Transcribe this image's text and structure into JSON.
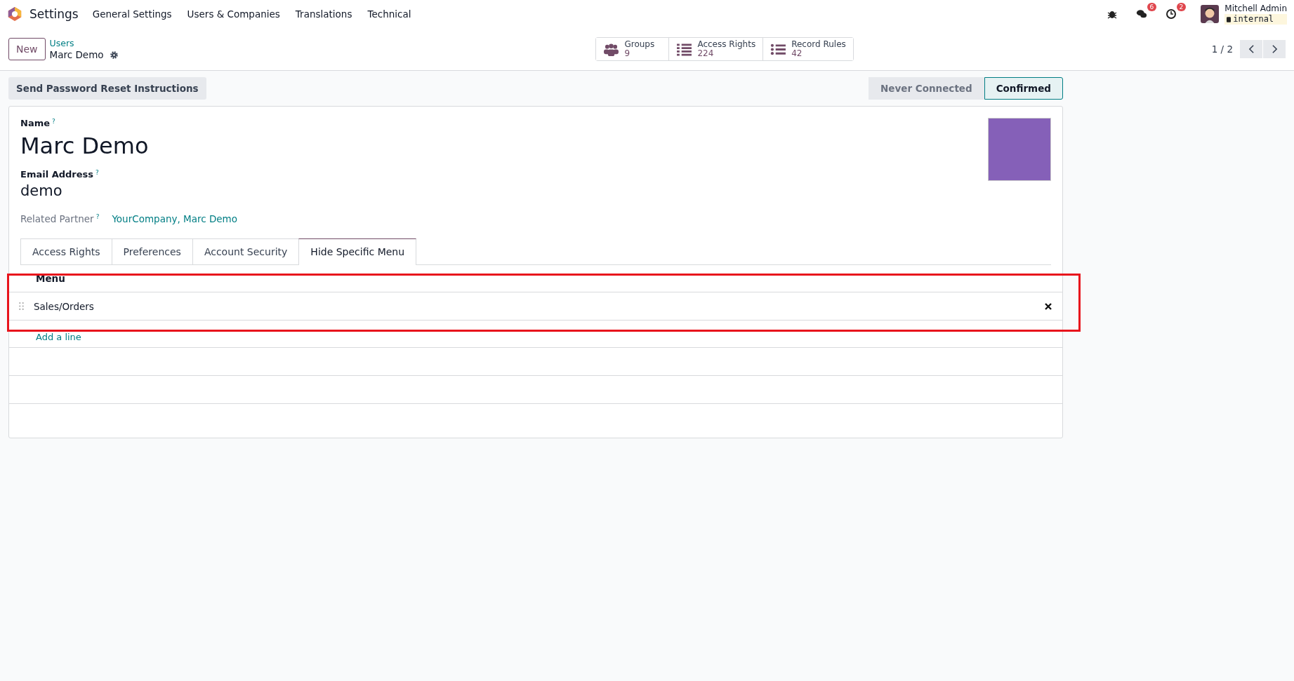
{
  "navbar": {
    "app_name": "Settings",
    "menu": [
      "General Settings",
      "Users & Companies",
      "Translations",
      "Technical"
    ],
    "messages_badge": "6",
    "activities_badge": "2",
    "user": {
      "name": "Mitchell Admin",
      "database": "internal"
    }
  },
  "control_panel": {
    "new_button": "New",
    "breadcrumb": "Users",
    "record_title": "Marc Demo",
    "smart_buttons": [
      {
        "kind": "groups",
        "label": "Groups",
        "value": "9"
      },
      {
        "kind": "list",
        "label": "Access Rights",
        "value": "224"
      },
      {
        "kind": "rules",
        "label": "Record Rules",
        "value": "42"
      }
    ],
    "pager": "1 / 2"
  },
  "action_button": "Send Password Reset Instructions",
  "statusbar": [
    {
      "label": "Never Connected",
      "selected": false
    },
    {
      "label": "Confirmed",
      "selected": true
    }
  ],
  "form": {
    "help_mark": "?",
    "name_label": "Name",
    "name_value": "Marc Demo",
    "email_label": "Email Address",
    "email_value": "demo",
    "partner_label": "Related Partner",
    "partner_value": "YourCompany, Marc Demo",
    "tabs": [
      {
        "label": "Access Rights",
        "selected": false
      },
      {
        "label": "Preferences",
        "selected": false
      },
      {
        "label": "Account Security",
        "selected": false
      },
      {
        "label": "Hide Specific Menu",
        "selected": true
      }
    ],
    "table": {
      "column": "Menu",
      "rows": [
        "Sales/Orders"
      ],
      "add_line": "Add a line"
    }
  }
}
